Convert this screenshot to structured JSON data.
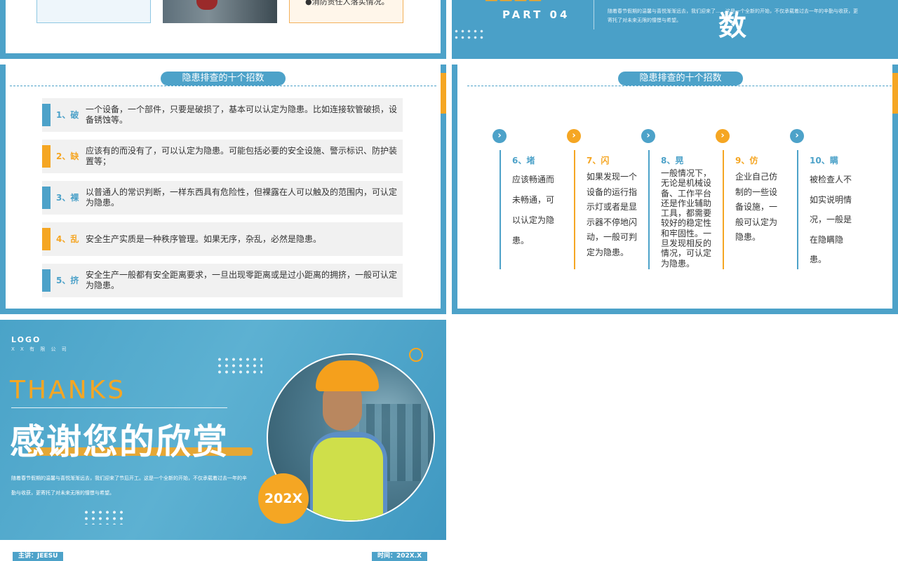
{
  "colors": {
    "accent_blue": "#4da2c9",
    "accent_orange": "#f5a623"
  },
  "slide_a": {
    "right_box_text": "●消防责任人落实情况。"
  },
  "slide_b": {
    "part_label": "PART 04",
    "description": "随着春节假期的温馨与喜悦渐渐远去，我们迎来了……这是一个全新的开始，不仅承载着过去一年的辛勤与收获，更寄托了对未来无限的憧憬与希望。",
    "title_fragment": "数"
  },
  "slide_c": {
    "title": "隐患排查的十个招数",
    "items": [
      {
        "num": "1、破",
        "text": "一个设备，一个部件，只要是破损了，基本可以认定为隐患。比如连接软管破损，设备锈蚀等。",
        "color": "blue"
      },
      {
        "num": "2、缺",
        "text": "应该有的而没有了，可以认定为隐患。可能包括必要的安全设施、警示标识、防护装置等；",
        "color": "orange"
      },
      {
        "num": "3、裸",
        "text": "以普通人的常识判断，一样东西具有危险性，但裸露在人可以触及的范围内，可认定为隐患。",
        "color": "blue"
      },
      {
        "num": "4、乱",
        "text": "安全生产实质是一种秩序管理。如果无序，杂乱，必然是隐患。",
        "color": "orange"
      },
      {
        "num": "5、挤",
        "text": "安全生产一般都有安全距离要求，一旦出现零距离或是过小距离的拥挤，一般可认定为隐患。",
        "color": "blue"
      }
    ]
  },
  "slide_d": {
    "title": "隐患排查的十个招数",
    "arrow_icon": "chevron-right-icon",
    "columns": [
      {
        "head": "6、堵",
        "body": "应该畅通而未畅通，可以认定为隐患。",
        "color": "blue"
      },
      {
        "head": "7、闪",
        "body": "如果发现一个设备的运行指示灯或者是显示器不停地闪动，一般可判定为隐患。",
        "color": "orange"
      },
      {
        "head": "8、晃",
        "body": "一般情况下，无论是机械设备、工作平台还是作业辅助工具，都需要较好的稳定性和牢固性。一旦发现相反的情况，可认定为隐患。",
        "color": "blue"
      },
      {
        "head": "9、仿",
        "body": "企业自己仿制的一些设备设施，一般可认定为隐患。",
        "color": "orange"
      },
      {
        "head": "10、瞒",
        "body": "被检查人不如实说明情况，一般是在隐瞒隐患。",
        "color": "blue"
      }
    ]
  },
  "slide_e": {
    "logo": "LOGO",
    "company": "X X 有 限 公 司",
    "thanks": "THANKS",
    "headline": "感谢您的欣赏",
    "paragraph": "随着春节假期的温馨与喜悦渐渐远去，我们迎来了节后开工。这是一个全新的开始，不仅承载着过去一年的辛勤与收获，更寄托了对未来无限的憧憬与希望。",
    "year": "202X",
    "speaker": "主讲：JEESU",
    "date": "时间：202X.X"
  }
}
